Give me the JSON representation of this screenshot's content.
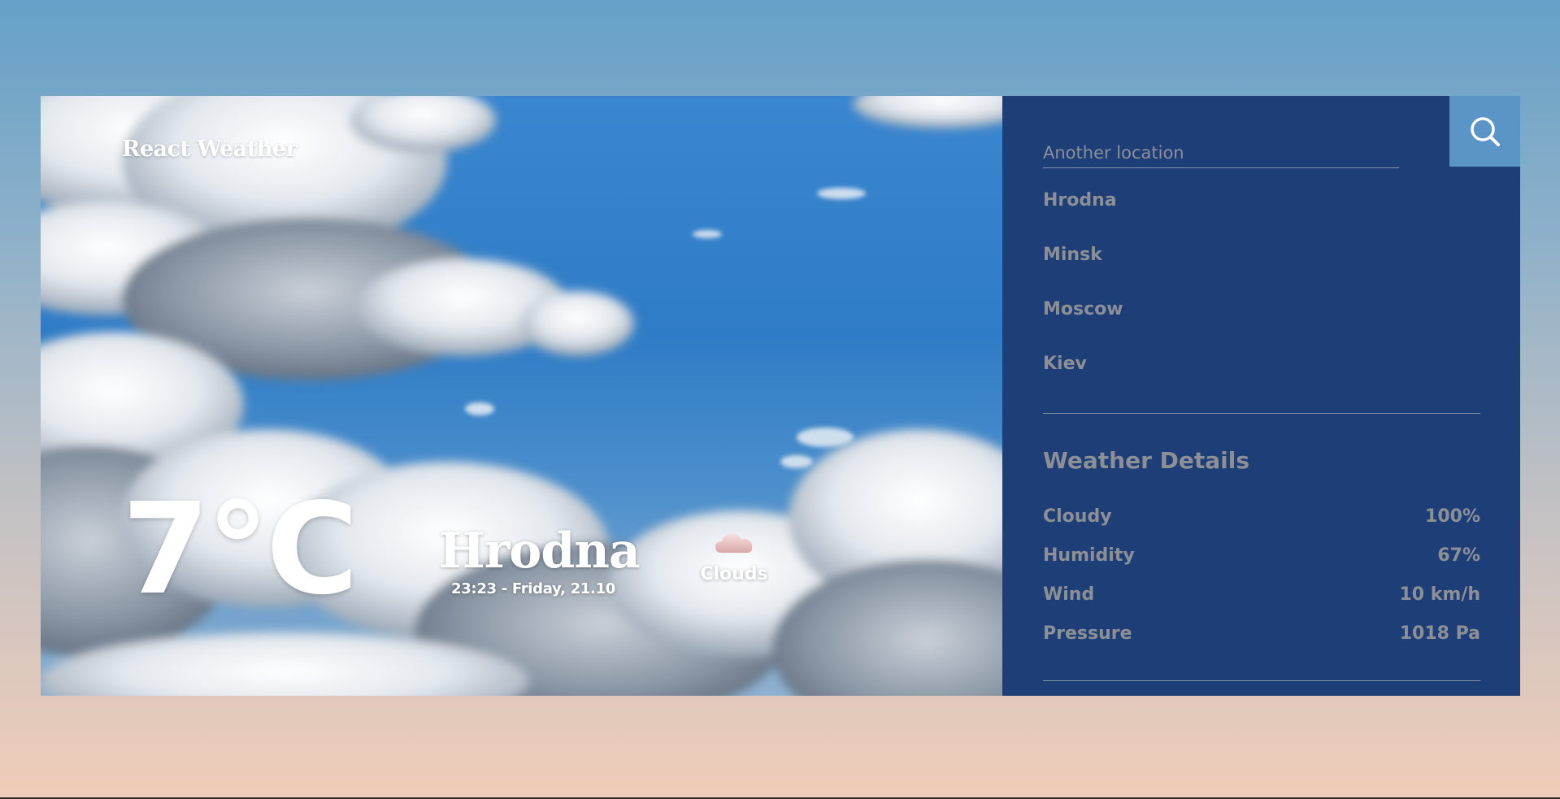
{
  "app": {
    "title": "React Weather"
  },
  "current": {
    "temperature": "7°C",
    "city": "Hrodna",
    "datetime": "23:23 - Friday, 21.10",
    "condition": "Clouds",
    "condition_icon": "cloud-icon"
  },
  "search": {
    "placeholder": "Another location",
    "value": "",
    "button_icon": "search-icon"
  },
  "locations": [
    "Hrodna",
    "Minsk",
    "Moscow",
    "Kiev"
  ],
  "details": {
    "title": "Weather Details",
    "rows": [
      {
        "label": "Cloudy",
        "value": "100%"
      },
      {
        "label": "Humidity",
        "value": "67%"
      },
      {
        "label": "Wind",
        "value": "10 km/h"
      },
      {
        "label": "Pressure",
        "value": "1018 Pa"
      }
    ]
  },
  "colors": {
    "panel_bg": "#1e3e78",
    "search_btn_bg": "#5b95c7",
    "muted_text": "#8d8f96",
    "hero_text": "#ffffff"
  }
}
